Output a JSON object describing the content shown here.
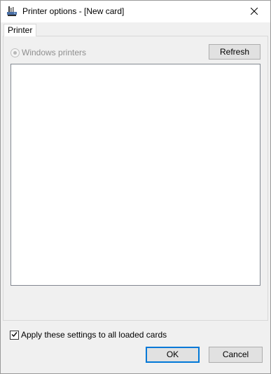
{
  "window": {
    "title": "Printer options - [New card]"
  },
  "tabs": [
    {
      "label": "Printer",
      "selected": true
    }
  ],
  "printer_tab": {
    "radio_label": "Windows printers",
    "radio_selected": true,
    "radio_enabled": false,
    "refresh_label": "Refresh",
    "printer_list": []
  },
  "footer": {
    "apply_all_label": "Apply these settings to all loaded cards",
    "apply_all_checked": true,
    "ok_label": "OK",
    "cancel_label": "Cancel"
  },
  "icons": {
    "app": "printer-icon",
    "close": "close-icon",
    "check": "checkmark-icon"
  },
  "colors": {
    "accent": "#0078d7",
    "disabled_text": "#8f8f8f",
    "window_bg": "#f0f0f0"
  }
}
